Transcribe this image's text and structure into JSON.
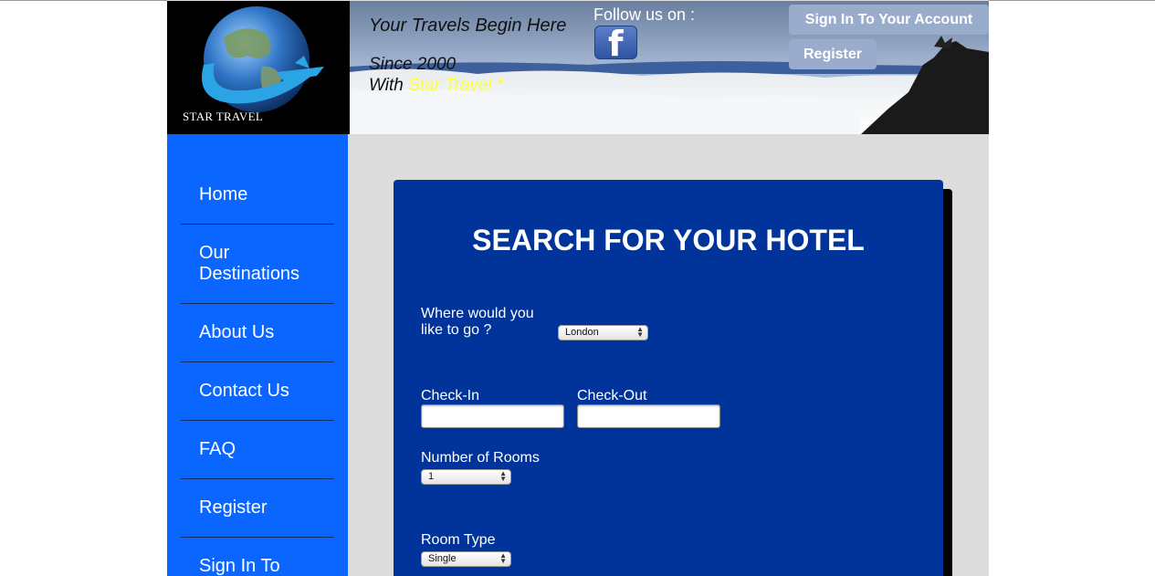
{
  "header": {
    "logo_text": "STAR TRAVEL",
    "tagline": "Your Travels Begin Here",
    "since": "Since 2000",
    "with_prefix": "With ",
    "brand_name": "Star Travel *",
    "follow_text": "Follow us on :",
    "facebook_icon": "facebook-icon",
    "signin_label": "Sign In To Your Account",
    "register_label": "Register"
  },
  "sidebar": {
    "items": [
      {
        "label": "Home"
      },
      {
        "label": "Our Destinations"
      },
      {
        "label": "About Us"
      },
      {
        "label": "Contact Us"
      },
      {
        "label": "FAQ"
      },
      {
        "label": "Register"
      },
      {
        "label": "Sign In To"
      }
    ]
  },
  "form": {
    "title": "SEARCH FOR YOUR HOTEL",
    "destination_label": "Where would you like to go ?",
    "destination_value": "London",
    "checkin_label": "Check-In",
    "checkin_value": "",
    "checkout_label": "Check-Out",
    "checkout_value": "",
    "rooms_label": "Number of Rooms",
    "rooms_value": "1",
    "roomtype_label": "Room Type",
    "roomtype_value": "Single"
  },
  "colors": {
    "sidebar": "#0b65ff",
    "panel": "#01349a",
    "brand_highlight": "#ffff33",
    "header_button": "#9aaccc"
  }
}
